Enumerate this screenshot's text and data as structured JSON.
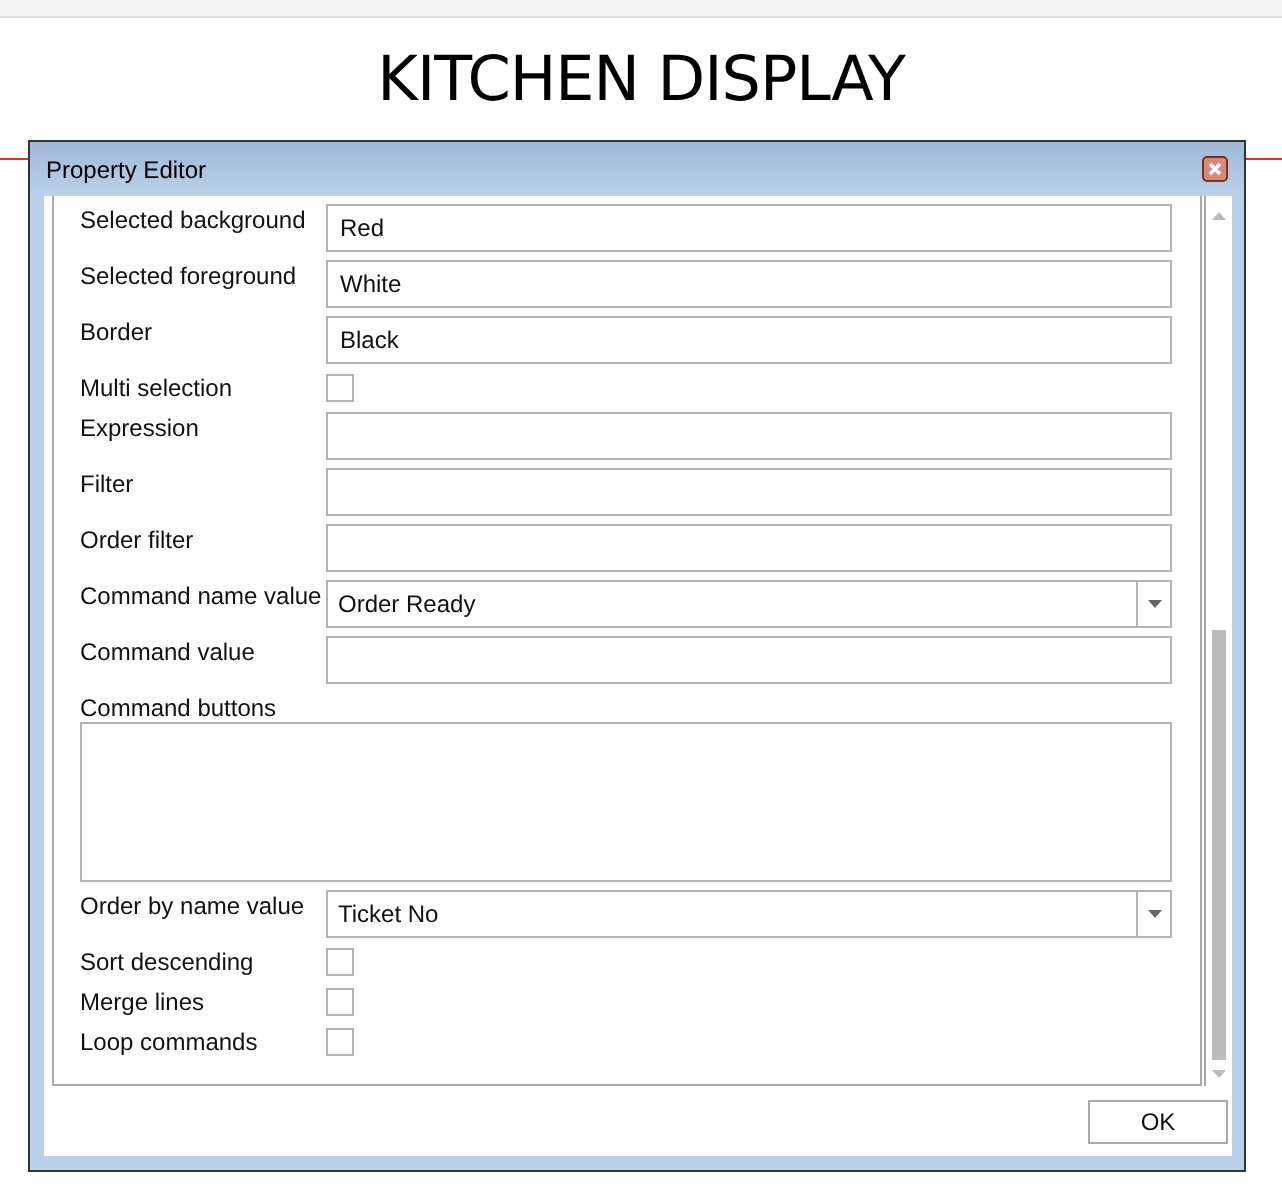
{
  "header": {
    "title": "KITCHEN DISPLAY"
  },
  "dialog": {
    "title": "Property Editor",
    "ok_button": "OK"
  },
  "properties": [
    {
      "kind": "text",
      "label": "Selected background",
      "value": "Red"
    },
    {
      "kind": "text",
      "label": "Selected foreground",
      "value": "White"
    },
    {
      "kind": "text",
      "label": "Border",
      "value": "Black"
    },
    {
      "kind": "checkbox",
      "label": "Multi selection",
      "checked": false
    },
    {
      "kind": "text",
      "label": "Expression"
    },
    {
      "kind": "text",
      "label": "Filter"
    },
    {
      "kind": "text",
      "label": "Order filter"
    },
    {
      "kind": "combo",
      "label": "Command name value",
      "value": "Order Ready"
    },
    {
      "kind": "text",
      "label": "Command value"
    },
    {
      "kind": "textarea",
      "label": "Command buttons"
    },
    {
      "kind": "combo",
      "label": "Order by name value",
      "value": "Ticket No"
    },
    {
      "kind": "checkbox",
      "label": "Sort descending",
      "checked": false
    },
    {
      "kind": "checkbox",
      "label": "Merge lines",
      "checked": false
    },
    {
      "kind": "checkbox",
      "label": "Loop commands",
      "checked": false
    }
  ]
}
